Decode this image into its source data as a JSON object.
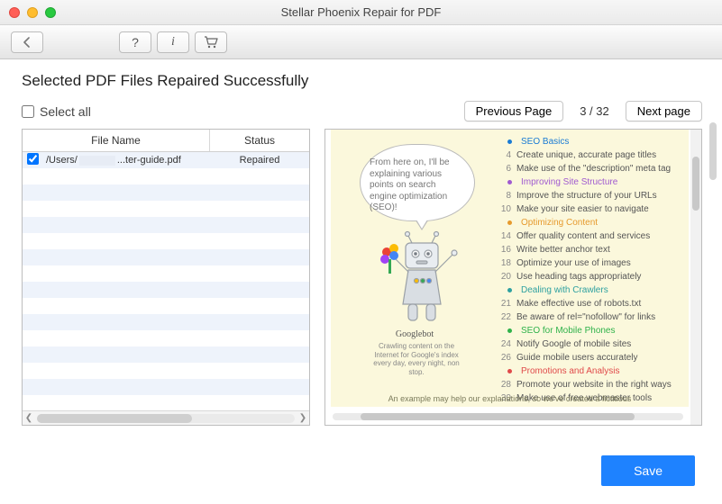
{
  "window": {
    "title": "Stellar Phoenix Repair for PDF"
  },
  "toolbar": {
    "help": "?",
    "info": "i"
  },
  "heading": "Selected PDF Files Repaired Successfully",
  "select_all_label": "Select all",
  "nav": {
    "prev": "Previous Page",
    "next": "Next page",
    "indicator": "3 / 32"
  },
  "table": {
    "headers": {
      "file_name": "File Name",
      "status": "Status"
    },
    "rows": [
      {
        "checked": true,
        "path_prefix": "/Users/",
        "path_suffix": "...ter-guide.pdf",
        "status": "Repaired"
      }
    ]
  },
  "preview": {
    "speech": "From here on, I'll be explaining various points on search engine optimization (SEO)!",
    "bot_name": "Googlebot",
    "bot_caption": "Crawling content on the Internet for Google's index every day, every night, non stop.",
    "toc": [
      {
        "type": "section",
        "color": "blue",
        "label": "SEO Basics"
      },
      {
        "type": "item",
        "num": "4",
        "label": "Create unique, accurate page titles"
      },
      {
        "type": "item",
        "num": "6",
        "label": "Make use of the \"description\" meta tag"
      },
      {
        "type": "section",
        "color": "purple",
        "label": "Improving Site Structure"
      },
      {
        "type": "item",
        "num": "8",
        "label": "Improve the structure of your URLs"
      },
      {
        "type": "item",
        "num": "10",
        "label": "Make your site easier to navigate"
      },
      {
        "type": "section",
        "color": "orange",
        "label": "Optimizing Content"
      },
      {
        "type": "item",
        "num": "14",
        "label": "Offer quality content and services"
      },
      {
        "type": "item",
        "num": "16",
        "label": "Write better anchor text"
      },
      {
        "type": "item",
        "num": "18",
        "label": "Optimize your use of images"
      },
      {
        "type": "item",
        "num": "20",
        "label": "Use heading tags appropriately"
      },
      {
        "type": "section",
        "color": "teal",
        "label": "Dealing with Crawlers"
      },
      {
        "type": "item",
        "num": "21",
        "label": "Make effective use of robots.txt"
      },
      {
        "type": "item",
        "num": "22",
        "label": "Be aware of rel=\"nofollow\" for links"
      },
      {
        "type": "section",
        "color": "green",
        "label": "SEO for Mobile Phones"
      },
      {
        "type": "item",
        "num": "24",
        "label": "Notify Google of mobile sites"
      },
      {
        "type": "item",
        "num": "26",
        "label": "Guide mobile users accurately"
      },
      {
        "type": "section",
        "color": "red",
        "label": "Promotions and Analysis"
      },
      {
        "type": "item",
        "num": "28",
        "label": "Promote your website in the right ways"
      },
      {
        "type": "item",
        "num": "30",
        "label": "Make use of free webmaster tools"
      }
    ],
    "footnote": "An example may help our explanations, so we've created a fictitious"
  },
  "save_label": "Save"
}
